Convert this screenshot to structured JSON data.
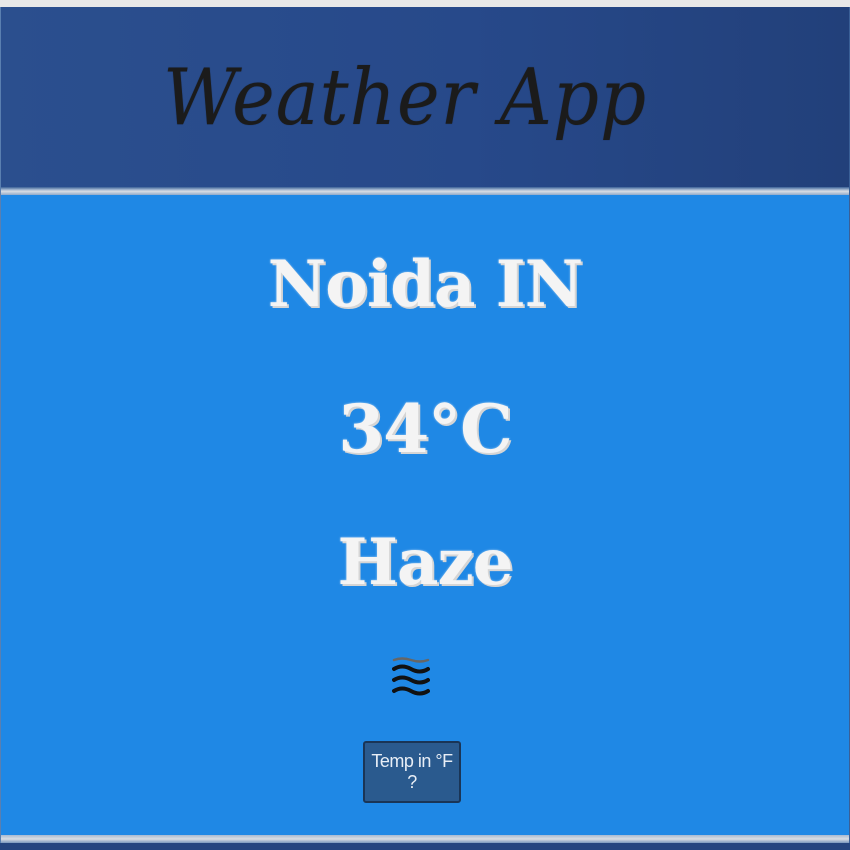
{
  "header": {
    "title": "Weather App"
  },
  "weather": {
    "city": "Noida IN",
    "temperature": "34°C",
    "description": "Haze",
    "icon": "haze-waves-icon"
  },
  "controls": {
    "toggle_label": "Temp in °F ?"
  },
  "colors": {
    "header_background": "#27498a",
    "main_background": "#1f88e5",
    "button_background": "#2a5a8e",
    "title_text": "#1b1b1b",
    "main_text": "#f4f4f4"
  }
}
